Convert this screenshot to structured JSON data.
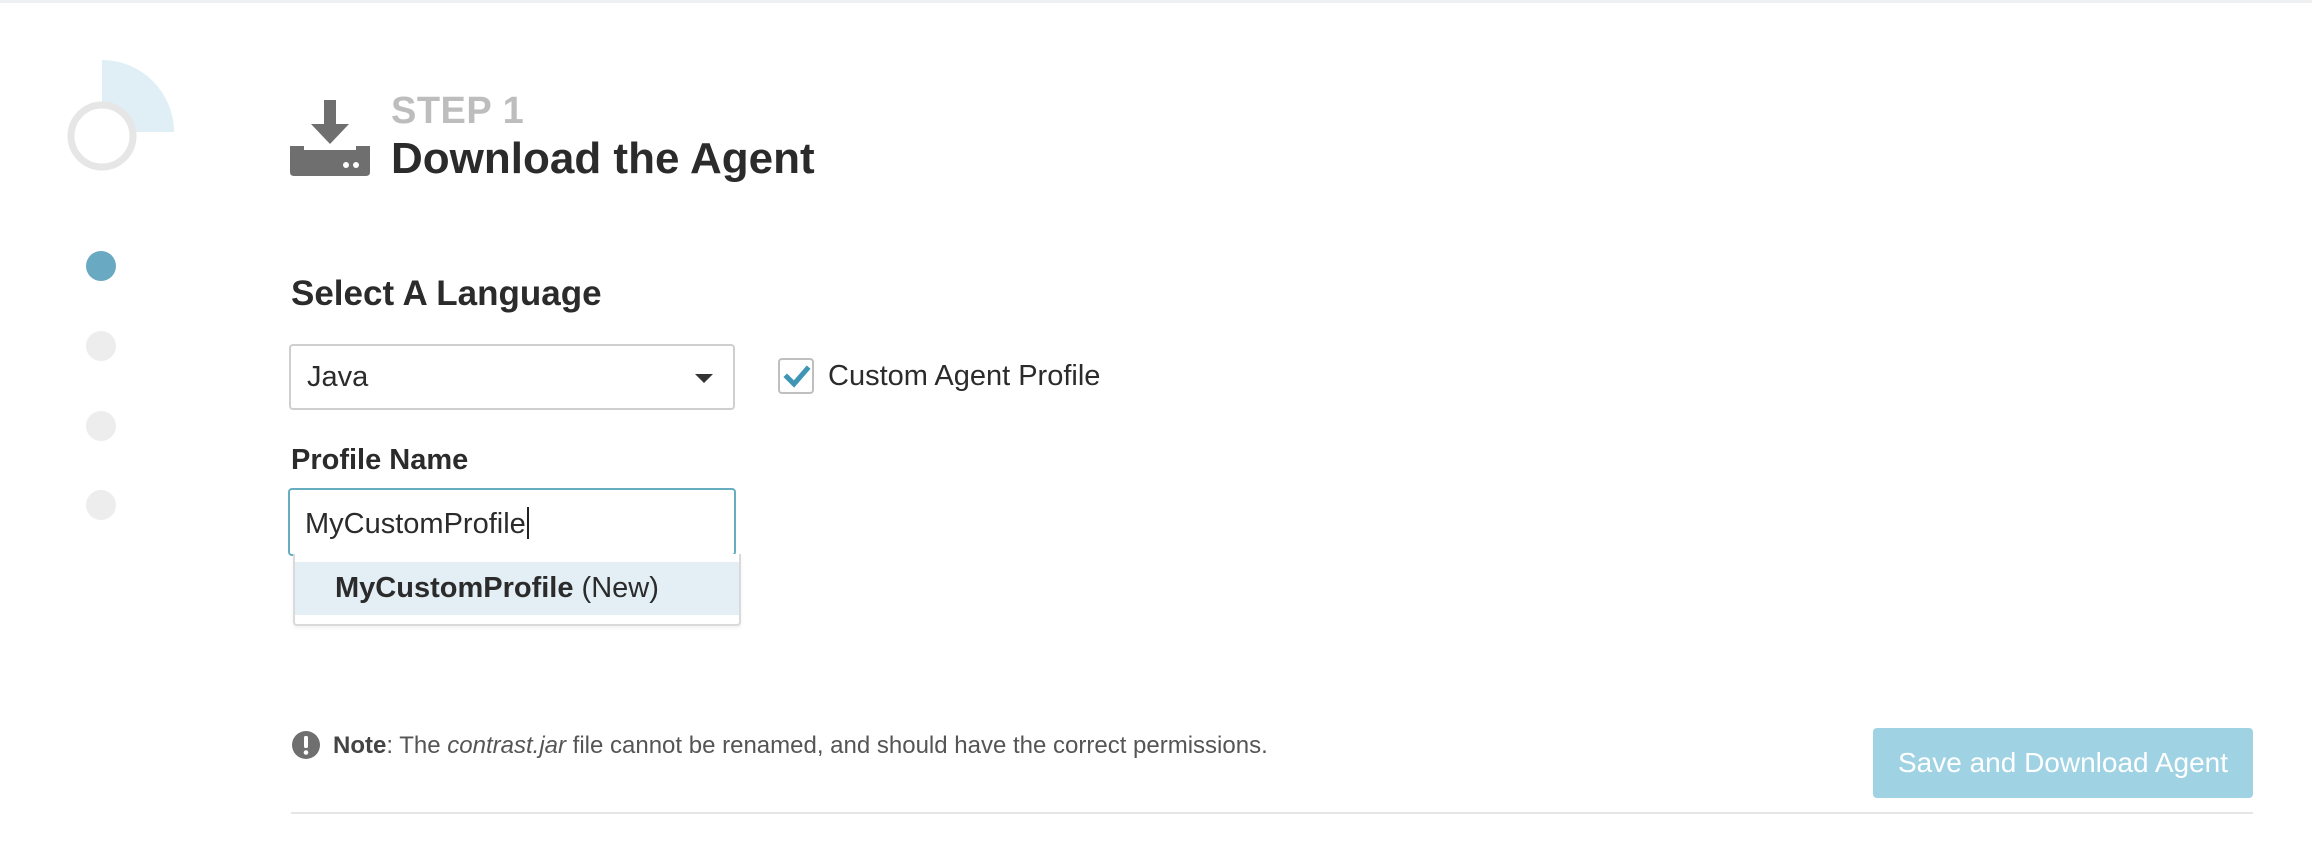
{
  "header": {
    "step_label": "STEP 1",
    "title": "Download the Agent",
    "icon": "download-icon"
  },
  "progress": {
    "current_step": 1,
    "total_steps": 4
  },
  "language_section": {
    "heading": "Select A Language",
    "select_value": "Java",
    "custom_profile_label": "Custom Agent Profile",
    "custom_profile_checked": true
  },
  "profile": {
    "label": "Profile Name",
    "input_value": "MyCustomProfile",
    "suggestion_name": "MyCustomProfile",
    "suggestion_tag": " (New)"
  },
  "note": {
    "icon": "exclamation-circle-icon",
    "label": "Note",
    "text_1": ": The ",
    "filename": "contrast.jar",
    "text_2": " file cannot be renamed, and should have the correct permissions."
  },
  "actions": {
    "save_button_label": "Save and Download Agent"
  },
  "colors": {
    "accent": "#6aa9c2",
    "button_disabled_bg": "#9fd2e3",
    "highlight_row": "#e3eff5",
    "input_focus_border": "#66aebf"
  }
}
